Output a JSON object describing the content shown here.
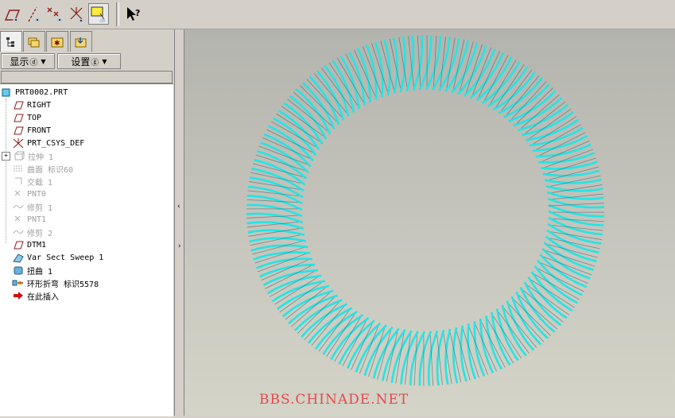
{
  "toolbar": {
    "icons": [
      "datum-plane-icon",
      "datum-axis-icon",
      "datum-point-icon",
      "coordinate-system-icon",
      "annotation-display-icon",
      "whats-this-help-icon"
    ]
  },
  "panel": {
    "tabs": [
      "model-tree-tab",
      "layer-tab",
      "favorites-tab",
      "connections-tab"
    ],
    "show_label": "显示",
    "show_key": "ⓓ",
    "settings_label": "设置",
    "settings_key": "ⓖ"
  },
  "tree": {
    "items": [
      {
        "label": "PRT0002.PRT",
        "icon": "part-icon",
        "dim": false
      },
      {
        "label": "RIGHT",
        "icon": "datum-plane-icon",
        "dim": false
      },
      {
        "label": "TOP",
        "icon": "datum-plane-icon",
        "dim": false
      },
      {
        "label": "FRONT",
        "icon": "datum-plane-icon",
        "dim": false
      },
      {
        "label": "PRT_CSYS_DEF",
        "icon": "csys-icon",
        "dim": false
      },
      {
        "label": "拉伸 1",
        "icon": "extrude-icon",
        "dim": true
      },
      {
        "label": "曲面 标识60",
        "icon": "surface-icon",
        "dim": true
      },
      {
        "label": "交截 1",
        "icon": "intersect-icon",
        "dim": true
      },
      {
        "label": "PNT0",
        "icon": "datum-point-icon",
        "dim": true
      },
      {
        "label": "修剪 1",
        "icon": "trim-icon",
        "dim": true
      },
      {
        "label": "PNT1",
        "icon": "datum-point-icon",
        "dim": true
      },
      {
        "label": "修剪 2",
        "icon": "trim-icon",
        "dim": true
      },
      {
        "label": "DTM1",
        "icon": "datum-plane-icon",
        "dim": false
      },
      {
        "label": "Var Sect Sweep 1",
        "icon": "sweep-icon",
        "dim": false
      },
      {
        "label": "扭曲 1",
        "icon": "warp-icon",
        "dim": false
      },
      {
        "label": "环形折弯 标识5578",
        "icon": "toroidal-bend-icon",
        "dim": false
      },
      {
        "label": "在此插入",
        "icon": "insert-here-arrow-icon",
        "dim": false
      }
    ]
  },
  "viewport": {
    "model": "toroidal-spring-coil",
    "coil_color": "#22e5e5",
    "watermark": "BBS.CHINADE.NET",
    "watermark_color": "#e34a4a"
  }
}
